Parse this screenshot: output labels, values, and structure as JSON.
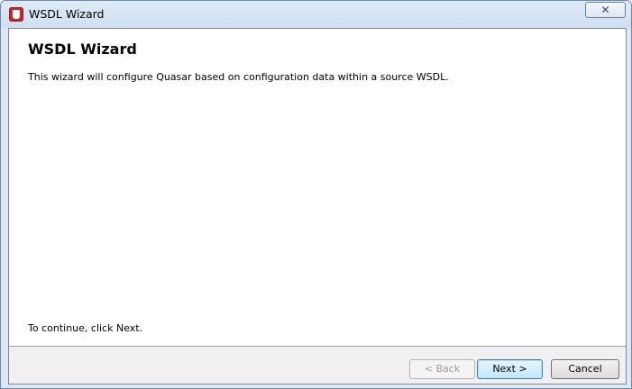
{
  "window": {
    "title": "WSDL Wizard",
    "close_glyph": "✕",
    "app_icon": "quasar-app-icon"
  },
  "page": {
    "heading": "WSDL Wizard",
    "description": "This wizard will configure Quasar based on configuration data within a source WSDL.",
    "continue_hint": "To continue, click Next."
  },
  "buttons": {
    "back_label": "< Back",
    "back_enabled": false,
    "next_label": "Next >",
    "next_default": true,
    "cancel_label": "Cancel"
  },
  "colors": {
    "app_icon": "#c62828",
    "next_button_border": "#3c7fb1"
  }
}
